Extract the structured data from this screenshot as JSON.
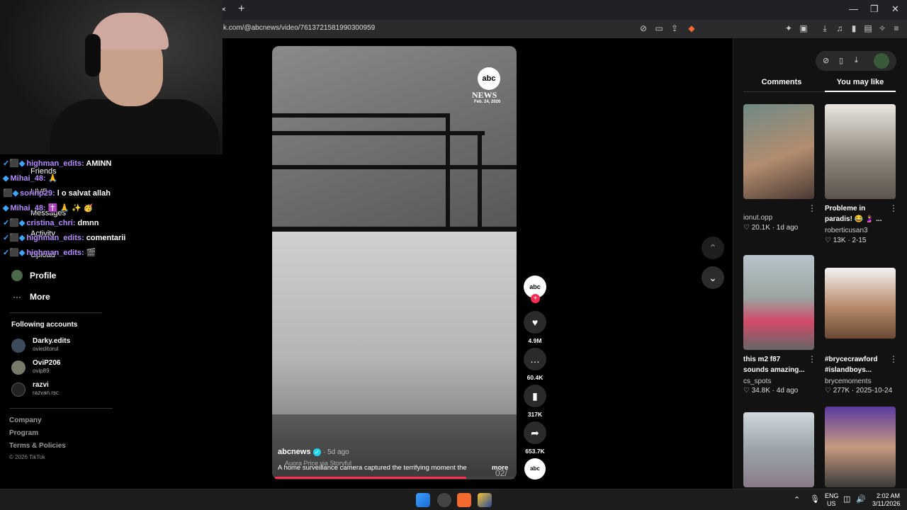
{
  "browser": {
    "tab_close": "×",
    "new_tab": "+",
    "url": "k.com/@abcnews/video/7613721581990300959",
    "window_controls": [
      "—",
      "❐",
      "✕"
    ]
  },
  "chat": [
    {
      "badges": "✓⬛◆",
      "user": "highman_edits:",
      "msg": "AMINN"
    },
    {
      "badges": "◆",
      "user": "Mihai_48:",
      "msg": "🙏"
    },
    {
      "badges": "⬛◆",
      "user": "sorinp29:",
      "msg": "l o salvat allah"
    },
    {
      "badges": "◆",
      "user": "Mihai_48:",
      "msg": "✝️ 🙏 ✨ 🥳"
    },
    {
      "badges": "✓⬛◆",
      "user": "cristina_chri:",
      "msg": "dmnn"
    },
    {
      "badges": "✓⬛◆",
      "user": "highman_edits:",
      "msg": "comentarii"
    },
    {
      "badges": "✓⬛◆",
      "user": "highman_edits:",
      "msg": "🎬"
    }
  ],
  "nav": {
    "hidden_items": [
      "Friends",
      "LIVE",
      "Messages",
      "Activity",
      "Upload"
    ],
    "profile": "Profile",
    "more": "More",
    "following_title": "Following accounts",
    "accounts": [
      {
        "name": "Darky.edits",
        "handle": "ovieditorul"
      },
      {
        "name": "OviP206",
        "handle": "ovip89"
      },
      {
        "name": "razvi",
        "handle": "razvan.rsc"
      }
    ],
    "footer": [
      "Company",
      "Program",
      "Terms & Policies"
    ],
    "copyright": "© 2026 TikTok"
  },
  "video": {
    "logo": "abc",
    "news": "NEWS",
    "date": "Feb. 24, 2026",
    "credit": "Auora Price via Storyful",
    "timestamp": "02/",
    "author": "abcnews",
    "ago": "· 5d ago",
    "caption": "A home surveillance camera captured the terrifying moment the",
    "more": "more",
    "progress": 0.8
  },
  "actions": {
    "likes": "4.9M",
    "comments": "60.4K",
    "saves": "317K",
    "shares": "653.7K"
  },
  "panel": {
    "tab_comments": "Comments",
    "tab_you_may_like": "You may like",
    "recs": [
      {
        "title": "",
        "user": "ionut.opp",
        "likes": "20.1K",
        "when": "1d ago"
      },
      {
        "title": "Probleme in paradis! 😂 🤰 ...",
        "user": "roberticusan3",
        "likes": "13K",
        "when": "2-15"
      },
      {
        "title": "this m2 f87 sounds amazing...",
        "user": "cs_spots",
        "likes": "34.8K",
        "when": "4d ago"
      },
      {
        "title": "#brycecrawford #islandboys...",
        "user": "brycemoments",
        "likes": "277K",
        "when": "2025-10-24"
      }
    ]
  },
  "taskbar": {
    "lang_top": "ENG",
    "lang_bottom": "US",
    "time": "2:02 AM",
    "date": "3/11/2026"
  }
}
